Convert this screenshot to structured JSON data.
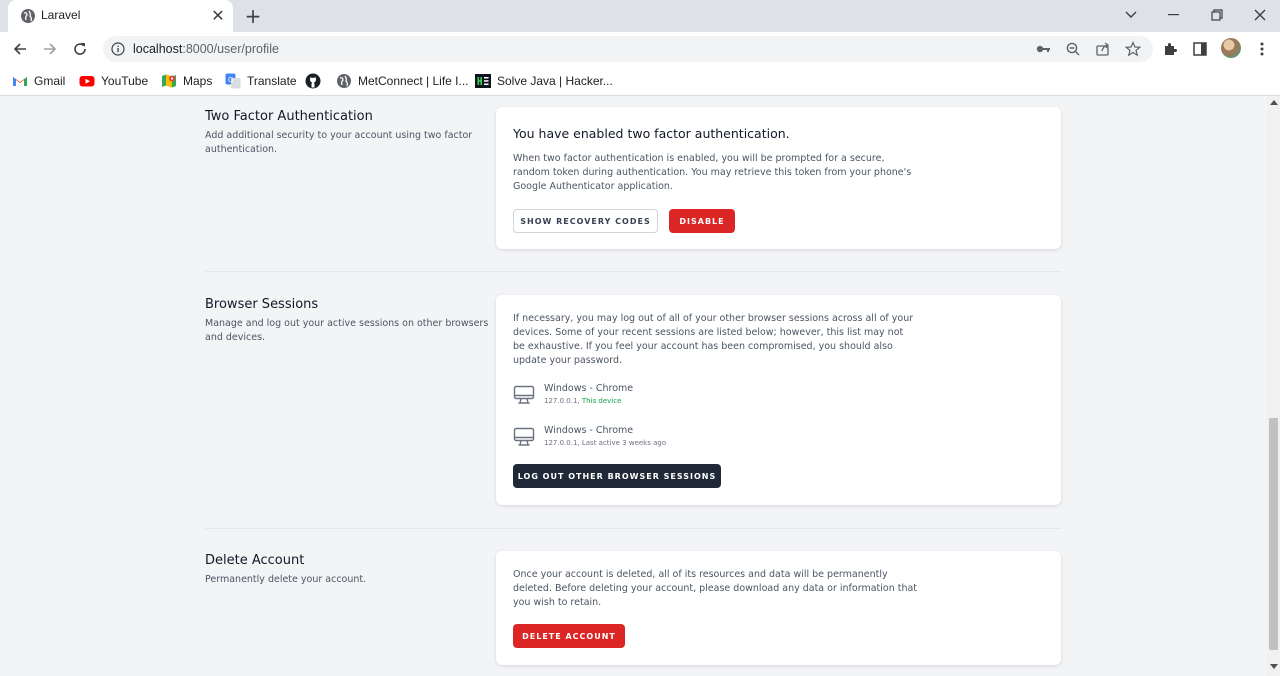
{
  "browser": {
    "tab_title": "Laravel",
    "tab_close": "✕",
    "new_tab": "+",
    "url_host": "localhost",
    "url_rest": ":8000/user/profile",
    "bookmarks": [
      {
        "label": "Gmail",
        "icon": "gmail-icon"
      },
      {
        "label": "YouTube",
        "icon": "youtube-icon"
      },
      {
        "label": "Maps",
        "icon": "maps-icon"
      },
      {
        "label": "Translate",
        "icon": "translate-icon"
      },
      {
        "label": "",
        "icon": "github-icon"
      },
      {
        "label": "MetConnect | Life I...",
        "icon": "globe-icon"
      },
      {
        "label": "Solve Java | Hacker...",
        "icon": "hackerrank-icon"
      }
    ]
  },
  "two_factor": {
    "title": "Two Factor Authentication",
    "description": "Add additional security to your account using two factor authentication.",
    "heading": "You have enabled two factor authentication.",
    "body": "When two factor authentication is enabled, you will be prompted for a secure, random token during authentication. You may retrieve this token from your phone's Google Authenticator application.",
    "show_codes_label": "Show Recovery Codes",
    "disable_label": "Disable"
  },
  "sessions": {
    "title": "Browser Sessions",
    "description": "Manage and log out your active sessions on other browsers and devices.",
    "body": "If necessary, you may log out of all of your other browser sessions across all of your devices. Some of your recent sessions are listed below; however, this list may not be exhaustive. If you feel your account has been compromised, you should also update your password.",
    "items": [
      {
        "name": "Windows - Chrome",
        "ip": "127.0.0.1, ",
        "status": "This device"
      },
      {
        "name": "Windows - Chrome",
        "ip": "127.0.0.1, ",
        "status": "Last active 3 weeks ago"
      }
    ],
    "logout_label": "Log Out Other Browser Sessions"
  },
  "delete_account": {
    "title": "Delete Account",
    "description": "Permanently delete your account.",
    "body": "Once your account is deleted, all of its resources and data will be permanently deleted. Before deleting your account, please download any data or information that you wish to retain.",
    "button_label": "Delete Account"
  },
  "colors": {
    "danger": "#dc2626",
    "dark_button": "#1f2937",
    "success": "#16a34a",
    "page_bg": "#f3f4f6"
  }
}
